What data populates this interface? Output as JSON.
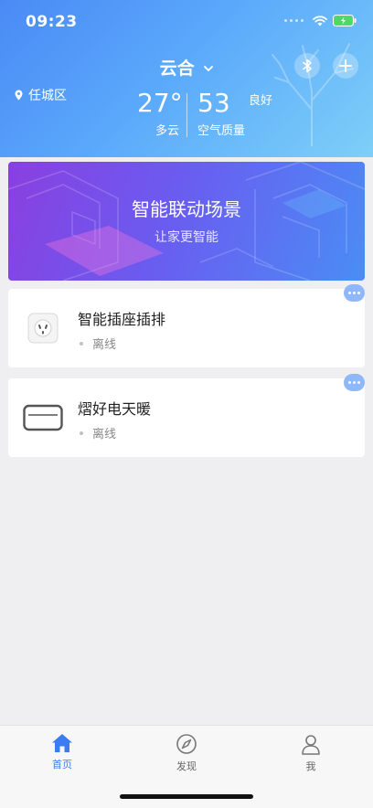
{
  "status_bar": {
    "time": "09:23"
  },
  "header": {
    "home_name": "云合",
    "location": "任城区",
    "weather": {
      "temperature": "27°",
      "condition": "多云",
      "aqi_value": "53",
      "aqi_level": "良好",
      "aqi_label": "空气质量"
    }
  },
  "banner": {
    "title": "智能联动场景",
    "subtitle": "让家更智能"
  },
  "devices": [
    {
      "name": "智能插座插排",
      "status": "离线",
      "icon": "power-socket-icon"
    },
    {
      "name": "熠好电天暖",
      "status": "离线",
      "icon": "heater-panel-icon"
    }
  ],
  "tabbar": {
    "items": [
      {
        "label": "首页",
        "icon": "home-icon",
        "active": true
      },
      {
        "label": "发现",
        "icon": "compass-icon",
        "active": false
      },
      {
        "label": "我",
        "icon": "profile-icon",
        "active": false
      }
    ]
  },
  "colors": {
    "accent": "#3c7cf2",
    "header_start": "#4a8af5",
    "header_end": "#7ecff8",
    "battery": "#4cd964"
  }
}
